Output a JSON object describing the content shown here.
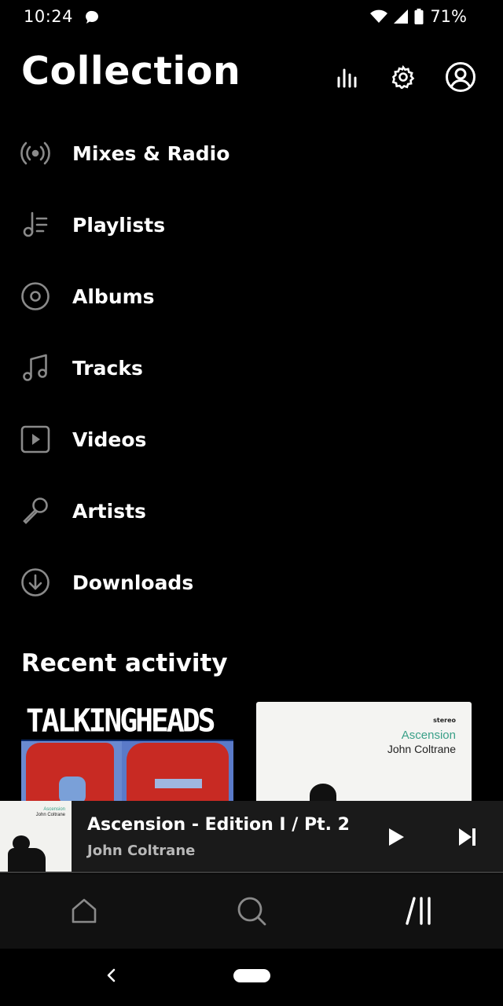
{
  "status_bar": {
    "time": "10:24",
    "battery": "71%"
  },
  "header": {
    "title": "Collection"
  },
  "menu": [
    {
      "label": "Mixes & Radio",
      "icon": "radio-icon"
    },
    {
      "label": "Playlists",
      "icon": "playlist-icon"
    },
    {
      "label": "Albums",
      "icon": "album-icon"
    },
    {
      "label": "Tracks",
      "icon": "music-note-icon"
    },
    {
      "label": "Videos",
      "icon": "video-icon"
    },
    {
      "label": "Artists",
      "icon": "microphone-icon"
    },
    {
      "label": "Downloads",
      "icon": "download-icon"
    }
  ],
  "recent": {
    "title": "Recent activity",
    "cards": [
      {
        "cover_text": "TALKINGHEADS"
      },
      {
        "stereo": "stereo",
        "album": "Ascension",
        "artist": "John Coltrane"
      }
    ]
  },
  "player": {
    "title": "Ascension - Edition I /  Pt. 2",
    "artist": "John Coltrane",
    "art": {
      "album": "Ascension",
      "artist": "John Coltrane"
    }
  },
  "colors": {
    "background": "#000000",
    "accent_green": "#3aa088",
    "secondary_text": "#b8b8b8"
  }
}
